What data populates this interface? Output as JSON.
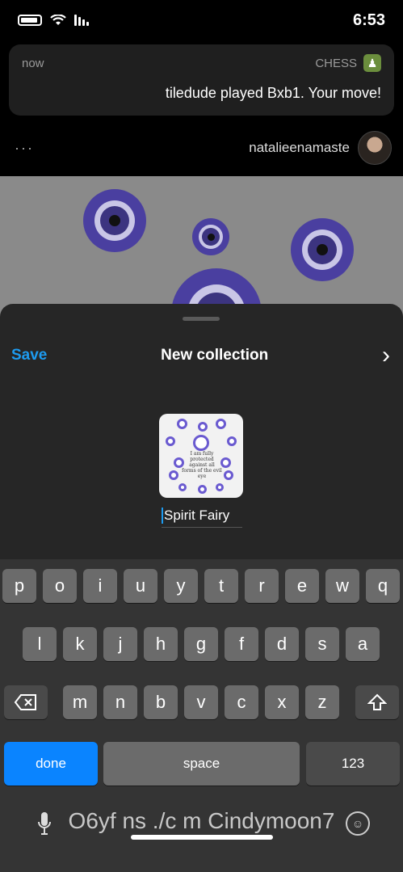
{
  "status": {
    "time": "6:53"
  },
  "notification": {
    "app_name": "CHESS",
    "timestamp": "now",
    "message": "tiledude played Bxb1. Your move!"
  },
  "post": {
    "username": "natalieenamaste",
    "more": "···"
  },
  "sheet": {
    "save_label": "Save",
    "title": "New collection",
    "chevron": "›",
    "collection_name": "Spirit Fairy",
    "thumbnail_text": "I am fully protected against all forms of the evil eye"
  },
  "keyboard": {
    "row1": [
      "q",
      "w",
      "e",
      "r",
      "t",
      "y",
      "u",
      "i",
      "o",
      "p"
    ],
    "row2": [
      "a",
      "s",
      "d",
      "f",
      "g",
      "h",
      "j",
      "k",
      "l"
    ],
    "row3": [
      "z",
      "x",
      "c",
      "v",
      "b",
      "n",
      "m"
    ],
    "numbers_label": "123",
    "space_label": "space",
    "done_label": "done",
    "dictation_text": "O6yf ns ./c m Cindymoon7"
  },
  "icons": [
    "battery-icon",
    "wifi-icon",
    "signal-icon",
    "chess-app-icon",
    "more-icon",
    "chevron-right-icon",
    "shift-icon",
    "delete-icon",
    "emoji-icon",
    "mic-icon"
  ],
  "colors": {
    "accent": "#1d9bf0",
    "done": "#0a84ff",
    "sheet": "#262626",
    "keyboard": "#343434"
  }
}
